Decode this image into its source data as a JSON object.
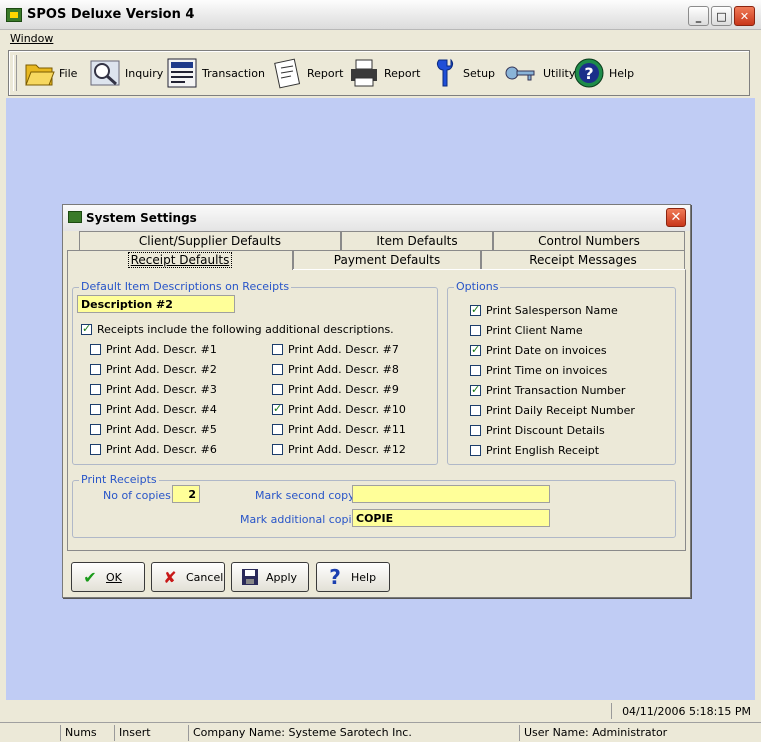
{
  "window": {
    "title": "SPOS Deluxe Version 4",
    "controls": [
      "_",
      "□",
      "✕"
    ]
  },
  "menubar": {
    "items": [
      "Window"
    ]
  },
  "toolbar": {
    "buttons": [
      {
        "label": "File",
        "icon": "folder-icon"
      },
      {
        "label": "Inquiry",
        "icon": "magnifier-icon"
      },
      {
        "label": "Transaction",
        "icon": "register-icon"
      },
      {
        "label": "Report",
        "icon": "notepad-icon"
      },
      {
        "label": "Report",
        "icon": "printer-icon"
      },
      {
        "label": "Setup",
        "icon": "wrench-icon"
      },
      {
        "label": "Utility",
        "icon": "key-icon"
      },
      {
        "label": "Help",
        "icon": "help-icon"
      }
    ]
  },
  "dialog": {
    "title": "System Settings",
    "tabs_back": [
      "Client/Supplier Defaults",
      "Item Defaults",
      "Control Numbers"
    ],
    "tabs_front": [
      "Receipt Defaults",
      "Payment Defaults",
      "Receipt Messages"
    ],
    "active_tab": "Receipt Defaults",
    "defaults_group": {
      "title": "Default Item Descriptions on Receipts",
      "description_value": "Description #2",
      "include_label": "Receipts include the following additional descriptions.",
      "include_checked": true,
      "descr_left": [
        {
          "label": "Print Add. Descr. #1",
          "checked": false
        },
        {
          "label": "Print Add. Descr. #2",
          "checked": false
        },
        {
          "label": "Print Add. Descr. #3",
          "checked": false
        },
        {
          "label": "Print Add. Descr. #4",
          "checked": false
        },
        {
          "label": "Print Add. Descr. #5",
          "checked": false
        },
        {
          "label": "Print Add. Descr. #6",
          "checked": false
        }
      ],
      "descr_right": [
        {
          "label": "Print Add. Descr. #7",
          "checked": false
        },
        {
          "label": "Print Add. Descr. #8",
          "checked": false
        },
        {
          "label": "Print Add. Descr. #9",
          "checked": false
        },
        {
          "label": "Print Add. Descr. #10",
          "checked": true
        },
        {
          "label": "Print Add. Descr. #11",
          "checked": false
        },
        {
          "label": "Print Add. Descr. #12",
          "checked": false
        }
      ]
    },
    "options_group": {
      "title": "Options",
      "items": [
        {
          "label": "Print Salesperson Name",
          "checked": true
        },
        {
          "label": "Print Client Name",
          "checked": false
        },
        {
          "label": "Print Date on invoices",
          "checked": true
        },
        {
          "label": "Print Time on invoices",
          "checked": false
        },
        {
          "label": "Print Transaction Number",
          "checked": true
        },
        {
          "label": "Print Daily Receipt Number",
          "checked": false
        },
        {
          "label": "Print Discount Details",
          "checked": false
        },
        {
          "label": "Print English Receipt",
          "checked": false
        }
      ]
    },
    "print_group": {
      "title": "Print Receipts",
      "copies_label": "No of copies:",
      "copies_value": "2",
      "second_label": "Mark second copy:",
      "second_value": "",
      "additional_label": "Mark additional copies",
      "additional_value": "COPIE"
    },
    "buttons": [
      {
        "label": "OK",
        "icon": "checkmark-icon"
      },
      {
        "label": "Cancel",
        "icon": "x-icon"
      },
      {
        "label": "Apply",
        "icon": "floppy-icon"
      },
      {
        "label": "Help",
        "icon": "help-icon"
      }
    ]
  },
  "status": {
    "datetime": "04/11/2006  5:18:15 PM",
    "cells": [
      "Nums",
      "Insert",
      "Company Name: Systeme Sarotech Inc.",
      "User Name: Administrator"
    ]
  },
  "colors": {
    "workspace": "#c0ccf4",
    "field_yellow": "#ffff99",
    "group_title": "#2855c8"
  }
}
